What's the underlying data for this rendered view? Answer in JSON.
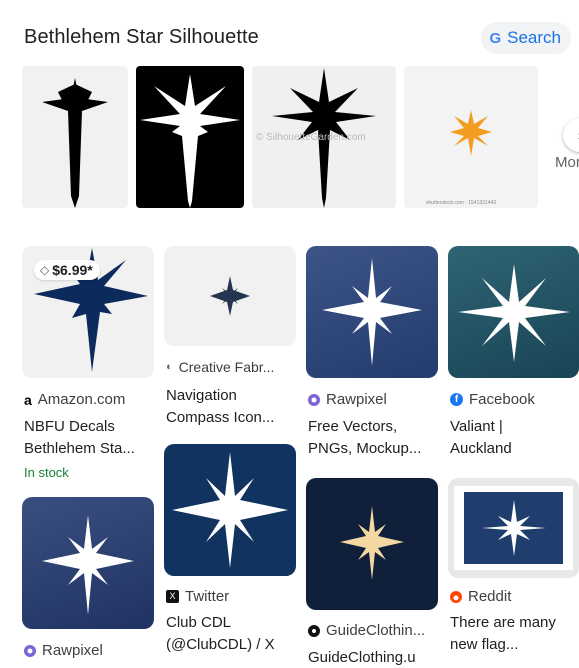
{
  "header": {
    "title": "Bethlehem Star Silhouette",
    "search_label": "Search",
    "search_icon": "google-g-icon"
  },
  "strip": {
    "watermark": "© SilhouetteGarden.com",
    "small_credit": "shutterstock.com · 1541331443",
    "more_label": "More"
  },
  "results": [
    {
      "source": "Amazon.com",
      "title_line1": "NBFU Decals",
      "title_line2": "Bethlehem Sta...",
      "price": "$6.99*",
      "stock": "In stock",
      "icon": "amazon-icon"
    },
    {
      "source": "Creative Fabr...",
      "title_line1": "Navigation",
      "title_line2": "Compass Icon...",
      "icon": "creative-fabrica-icon"
    },
    {
      "source": "Rawpixel",
      "title_line1": "Free Vectors,",
      "title_line2": "PNGs, Mockup...",
      "icon": "rawpixel-icon"
    },
    {
      "source": "Facebook",
      "title_line1": "Valiant |",
      "title_line2": "Auckland",
      "icon": "facebook-icon"
    },
    {
      "source": "Twitter",
      "title_line1": "Club CDL",
      "title_line2": "(@ClubCDL) / X",
      "icon": "twitter-icon"
    },
    {
      "source": "GuideClothin...",
      "title_line1": "GuideClothing.u",
      "icon": "guideclothing-icon"
    },
    {
      "source": "Reddit",
      "title_line1": "There are many",
      "title_line2": "new flag...",
      "icon": "reddit-icon"
    },
    {
      "source": "Rawpixel",
      "icon": "rawpixel-icon"
    }
  ],
  "colors": {
    "accent": "#1a73e8",
    "stock_green": "#188038",
    "navy": "#0d2a5c",
    "gold": "#f3d8a4",
    "orange": "#f29d1f"
  }
}
